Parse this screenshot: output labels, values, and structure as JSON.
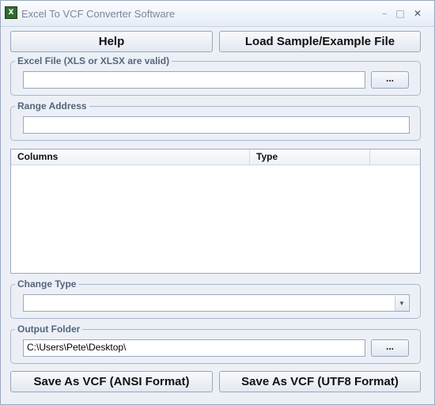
{
  "window": {
    "title": "Excel To VCF Converter Software",
    "minimize": "–",
    "maximize": "□",
    "close": "✕"
  },
  "toolbar": {
    "help_label": "Help",
    "load_sample_label": "Load Sample/Example File"
  },
  "excel_file": {
    "label": "Excel File (XLS or XLSX are valid)",
    "value": "",
    "browse_label": "..."
  },
  "range_address": {
    "label": "Range Address",
    "value": ""
  },
  "columns_list": {
    "headers": [
      "Columns",
      "Type"
    ],
    "rows": []
  },
  "change_type": {
    "label": "Change Type",
    "value": ""
  },
  "output_folder": {
    "label": "Output Folder",
    "value": "C:\\Users\\Pete\\Desktop\\",
    "browse_label": "..."
  },
  "actions": {
    "save_ansi_label": "Save As VCF (ANSI Format)",
    "save_utf8_label": "Save As VCF (UTF8 Format)"
  }
}
